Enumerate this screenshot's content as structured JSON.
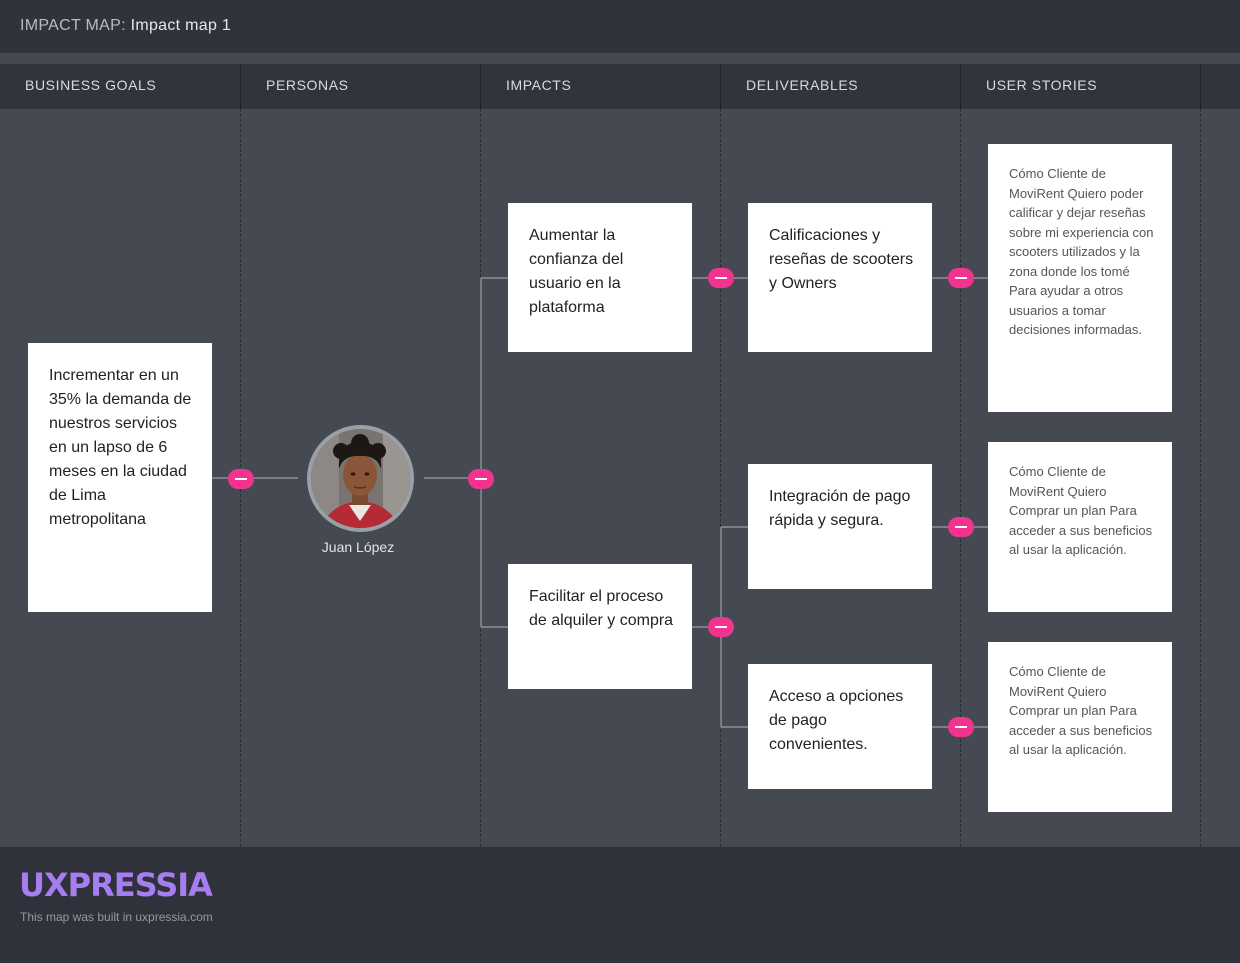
{
  "header": {
    "prefix": "IMPACT MAP:",
    "title": "Impact map 1"
  },
  "columns": [
    "BUSINESS GOALS",
    "PERSONAS",
    "IMPACTS",
    "DELIVERABLES",
    "USER STORIES"
  ],
  "goal": {
    "text": "Incrementar en un 35% la demanda de nuestros servicios en un lapso de 6 meses en la ciudad de Lima metropolitana"
  },
  "persona": {
    "name": "Juan López"
  },
  "impacts": [
    {
      "text": "Aumentar la confianza del usuario en la plataforma"
    },
    {
      "text": "Facilitar el proceso de alquiler y compra"
    }
  ],
  "deliverables": [
    {
      "text": "Calificaciones y reseñas de scooters y Owners"
    },
    {
      "text": "Integración de pago rápida y segura."
    },
    {
      "text": "Acceso a opciones de pago convenientes."
    }
  ],
  "stories": [
    {
      "text": "Cómo Cliente de MoviRent Quiero poder calificar y dejar reseñas sobre mi experiencia con scooters utilizados y la zona donde los tomé Para ayudar a otros usuarios a tomar decisiones informadas."
    },
    {
      "text": "Cómo Cliente de MoviRent Quiero Comprar un plan Para acceder a sus beneficios al usar la aplicación."
    },
    {
      "text": "Cómo Cliente de MoviRent Quiero Comprar un plan Para acceder a sus beneficios al usar la aplicación."
    }
  ],
  "footer": {
    "logo": "UXPRESSIA",
    "built": "This map was built in uxpressia.com"
  },
  "colors": {
    "accent": "#f2338f",
    "logo": "#a67ef0",
    "canvas": "#454952"
  },
  "icons": {
    "toggle": "collapse-minus-icon"
  }
}
